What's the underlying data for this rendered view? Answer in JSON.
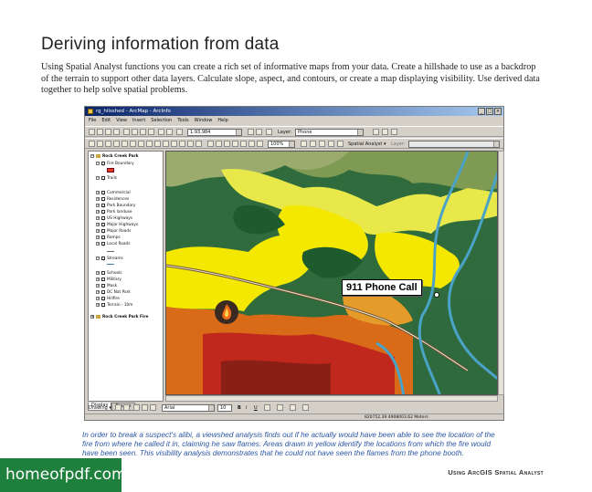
{
  "page": {
    "title": "Deriving information from data",
    "intro": "Using Spatial Analyst functions you can create a rich set of informative maps from your data. Create a hillshade to use as a backdrop of the terrain to support other data layers. Calculate slope, aspect, and contours, or create a map displaying visibility. Use derived data together to help solve spatial problems.",
    "caption": "In order to break a suspect's alibi, a viewshed analysis finds out if he actually would have been able to see the location of the fire from where he called it in, claiming he saw flames. Areas drawn in yellow identify the locations from which the fire would have been seen. This visibility analysis demonstrates that he could not have seen the flames from the phone booth.",
    "footer_label": "Using ArcGIS Spatial Analyst",
    "watermark": "homeofpdf.com"
  },
  "window": {
    "title": "rg_hilsshed - ArcMap - ArcInfo",
    "controls": [
      "_",
      "□",
      "×"
    ],
    "menu": [
      "File",
      "Edit",
      "View",
      "Insert",
      "Selection",
      "Tools",
      "Window",
      "Help"
    ]
  },
  "toolbar": {
    "scale": "1:93,984",
    "layer_label": "Layer:",
    "layer_value": "Phone",
    "zoom": "100%",
    "spatial_analyst_label": "Spatial Analyst ▾",
    "layer2_label": "Layer:"
  },
  "toc": {
    "items": [
      {
        "label": "Rock Creek Park",
        "level": 0,
        "bold": true
      },
      {
        "label": "Fire Boundary",
        "level": 1
      },
      {
        "label": "Trails",
        "level": 1
      },
      {
        "label": "Commercial",
        "level": 1
      },
      {
        "label": "Residences",
        "level": 1
      },
      {
        "label": "Park Boundary",
        "level": 1
      },
      {
        "label": "Park landuse",
        "level": 1
      },
      {
        "label": "US Highways",
        "level": 1
      },
      {
        "label": "Major Highways",
        "level": 1
      },
      {
        "label": "Major Roads",
        "level": 1
      },
      {
        "label": "Ramps",
        "level": 1
      },
      {
        "label": "Local Roads",
        "level": 1
      },
      {
        "label": "Streams",
        "level": 1
      },
      {
        "label": "Schools",
        "level": 1
      },
      {
        "label": "Military",
        "level": 1
      },
      {
        "label": "Mask",
        "level": 1
      },
      {
        "label": "DC Nat Park",
        "level": 1
      },
      {
        "label": "Hillfire",
        "level": 1
      },
      {
        "label": "Terrain - 10m",
        "level": 1
      },
      {
        "label": "Rock Creek Park Fire",
        "level": 0,
        "bold": true
      }
    ],
    "tabs": [
      "Display",
      "Source"
    ]
  },
  "map": {
    "callout": "911 Phone Call"
  },
  "drawbar": {
    "drawing_label": "Drawing ▾",
    "font": "Arial",
    "font_size": "10",
    "bold": "B",
    "italic": "I",
    "underline": "U"
  },
  "status": {
    "coords": "820752.39  4908003.62 Meters"
  },
  "colors": {
    "yellow_visible": "#f5e800",
    "dark_green": "#1f5a2f",
    "red_fire": "#c0281e",
    "stream_blue": "#4aa3c7",
    "footer_green": "#1f7f3c",
    "caption_blue": "#2c57a6"
  }
}
